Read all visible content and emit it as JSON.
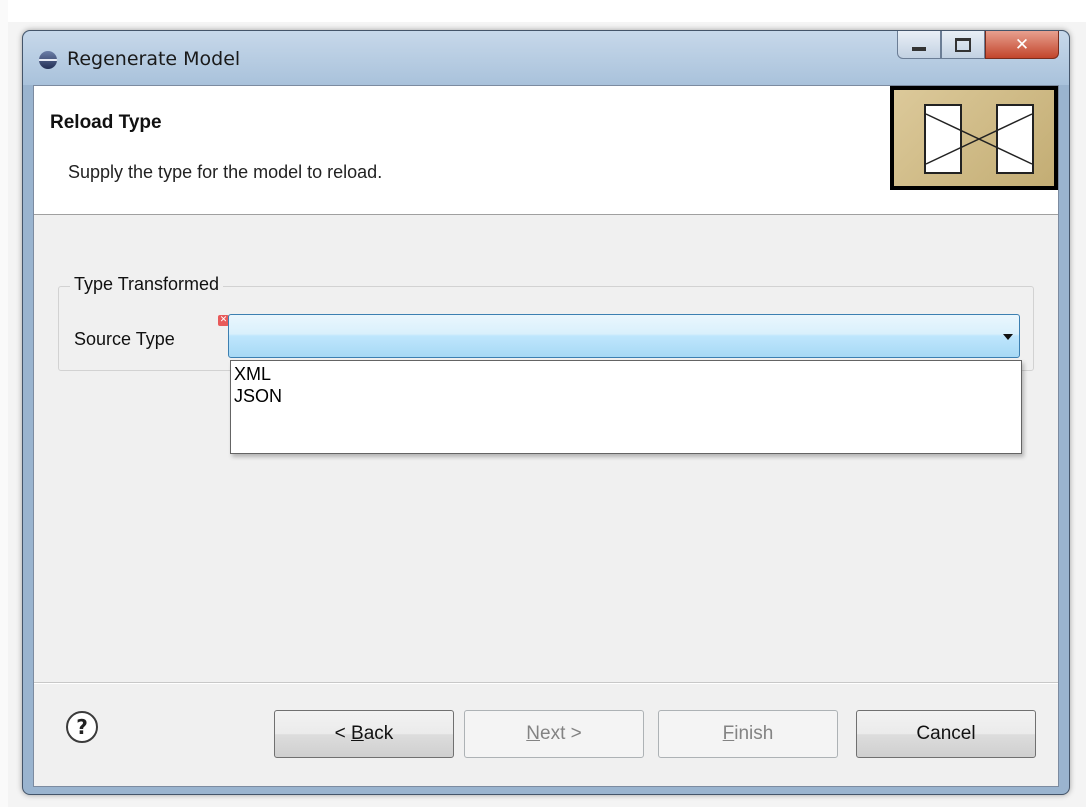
{
  "window": {
    "title": "Regenerate Model"
  },
  "header": {
    "title": "Reload Type",
    "description": "Supply the type for the model to reload."
  },
  "group": {
    "label": "Type Transformed",
    "source_label": "Source Type",
    "source_value": ""
  },
  "dropdown": {
    "options": [
      "XML",
      "JSON"
    ]
  },
  "buttons": {
    "back": {
      "mnemonic": "B",
      "before": "< ",
      "after": "ack"
    },
    "next": {
      "mnemonic": "N",
      "before": "",
      "after": "ext >"
    },
    "finish": {
      "mnemonic": "F",
      "before": "",
      "after": "inish"
    },
    "cancel": "Cancel"
  },
  "icons": {
    "title": "eclipse-icon",
    "banner": "wizard-banner-icon",
    "help": "help-icon",
    "error": "error-icon"
  }
}
